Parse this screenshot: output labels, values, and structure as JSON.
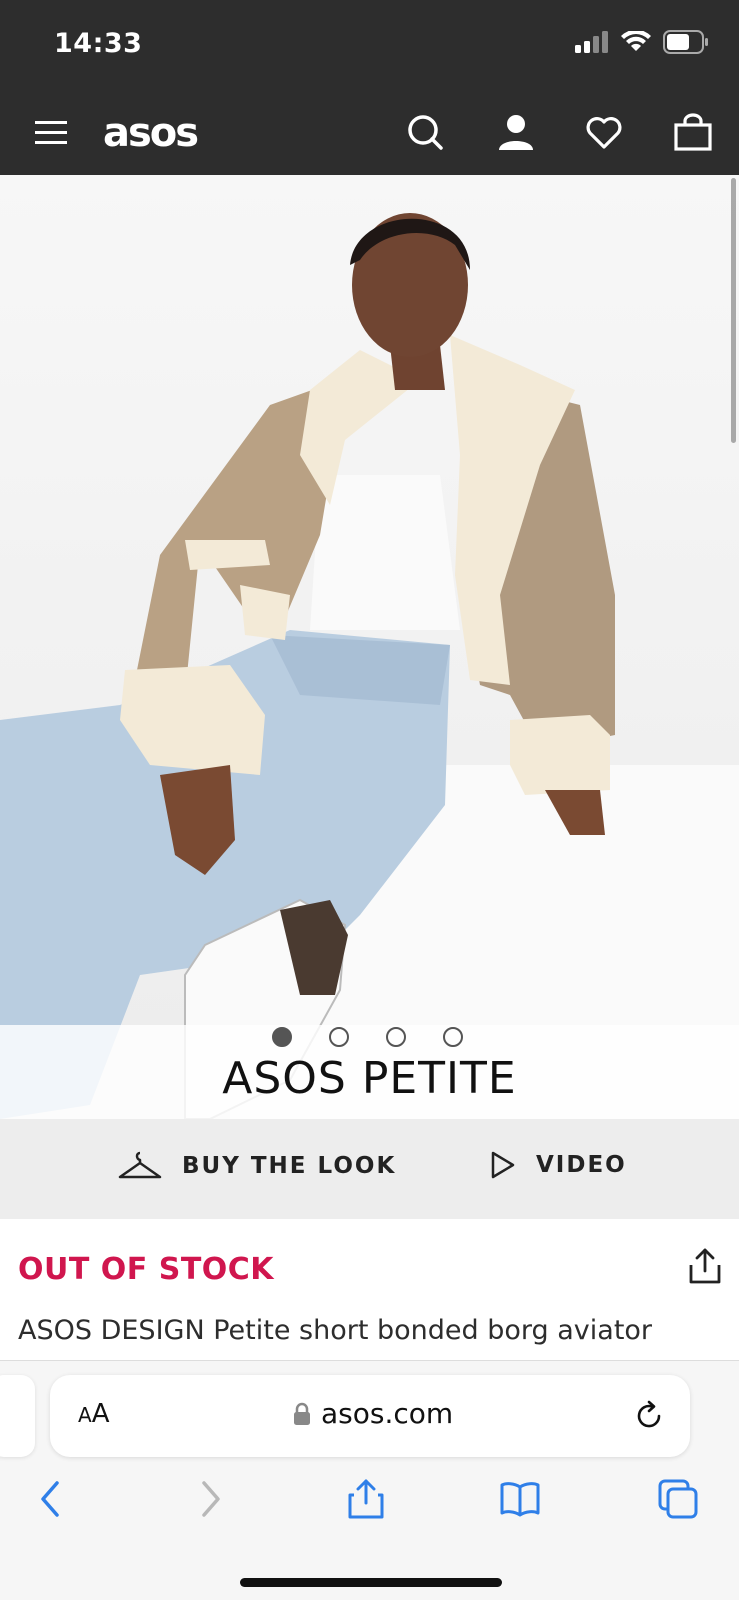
{
  "status_bar": {
    "time": "14:33"
  },
  "nav": {
    "logo": "asos",
    "icons": [
      "menu-icon",
      "search-icon",
      "account-icon",
      "wishlist-icon",
      "bag-icon"
    ]
  },
  "hero": {
    "brand_label": "ASOS PETITE",
    "carousel_dots": 4,
    "active_dot": 0
  },
  "actions": {
    "buy_the_look": "BUY THE LOOK",
    "video": "VIDEO"
  },
  "product": {
    "stock_status": "OUT OF STOCK",
    "title": "ASOS DESIGN Petite short bonded borg aviator"
  },
  "browser": {
    "text_size_label_big": "A",
    "text_size_label_small": "A",
    "url": "asos.com"
  },
  "colors": {
    "header_bg": "#2d2d2d",
    "stock_red": "#d0164e",
    "safari_blue": "#2f7fe8"
  }
}
